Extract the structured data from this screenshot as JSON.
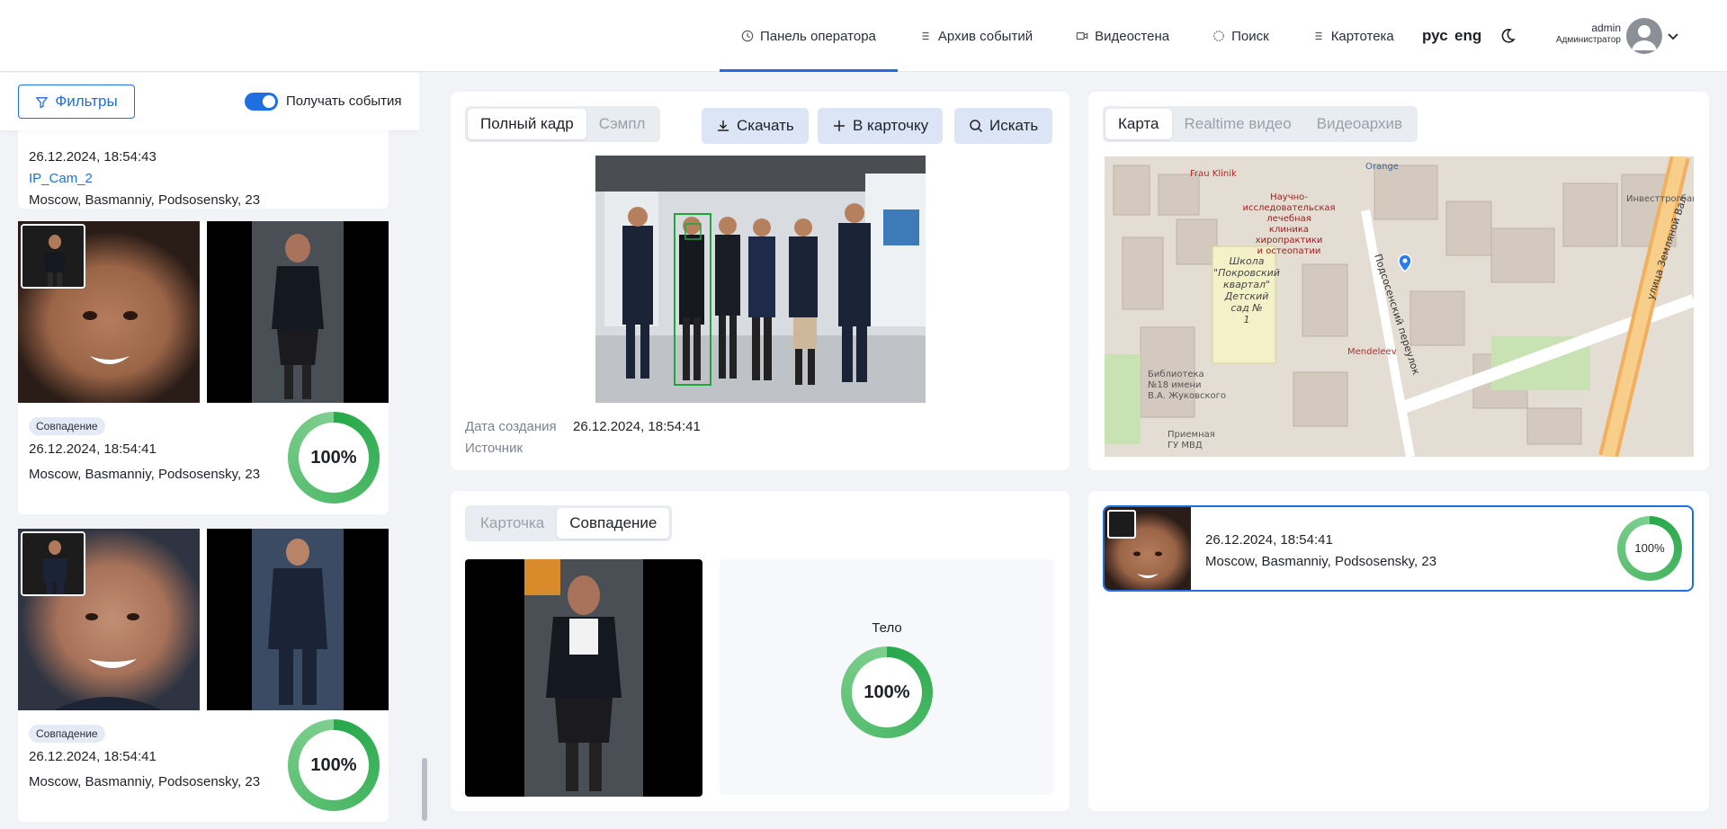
{
  "header": {
    "nav": [
      {
        "label": "Панель оператора",
        "icon": "clock-icon",
        "active": true
      },
      {
        "label": "Архив событий",
        "icon": "list-icon",
        "active": false
      },
      {
        "label": "Видеостена",
        "icon": "video-icon",
        "active": false
      },
      {
        "label": "Поиск",
        "icon": "target-icon",
        "active": false
      },
      {
        "label": "Картотека",
        "icon": "list-icon",
        "active": false
      }
    ],
    "lang_ru": "рус",
    "lang_en": "eng",
    "user_name": "admin",
    "user_role": "Администратор"
  },
  "left": {
    "filter_label": "Фильтры",
    "toggle_label": "Получать события",
    "first_event": {
      "time": "26.12.2024, 18:54:43",
      "camera": "IP_Cam_2",
      "address": "Moscow, Basmanniy, Podsosensky, 23"
    },
    "events": [
      {
        "badge": "Совпадение",
        "time": "26.12.2024, 18:54:41",
        "address": "Moscow, Basmanniy, Podsosensky, 23",
        "score": "100%"
      },
      {
        "badge": "Совпадение",
        "time": "26.12.2024, 18:54:41",
        "address": "Moscow, Basmanniy, Podsosensky, 23",
        "score": "100%"
      }
    ]
  },
  "frame_panel": {
    "tabs": [
      "Полный кадр",
      "Сэмпл"
    ],
    "buttons": {
      "download": "Скачать",
      "to_card": "В карточку",
      "search": "Искать"
    },
    "created_label": "Дата создания",
    "created_value": "26.12.2024, 18:54:41",
    "source_label": "Источник"
  },
  "map_panel": {
    "tabs": [
      "Карта",
      "Realtime видео",
      "Видеоархив"
    ],
    "labels": [
      "Frau Klinik",
      "Научно-исследовательская лечебная клиника хиропрактики и остеопатии",
      "Школа \"Покровский квартал\" Детский сад № 1",
      "Подсосенский переулок",
      "Mendeleev",
      "Библиотека №18 имени В.А. Жуковского",
      "Приемная ГУ МВД",
      "улица Земляной Вал",
      "Инвесттрогбанк",
      "Orange"
    ]
  },
  "compare_panel": {
    "tabs": [
      "Карточка",
      "Совпадение"
    ],
    "metric_label": "Тело",
    "metric_score": "100%"
  },
  "match_list": {
    "time": "26.12.2024, 18:54:41",
    "address": "Moscow, Basmanniy, Podsosensky, 23",
    "score": "100%"
  },
  "colors": {
    "accent": "#1f6fe0",
    "ring_start": "#27a84a",
    "ring_end": "#7fcf8e"
  }
}
